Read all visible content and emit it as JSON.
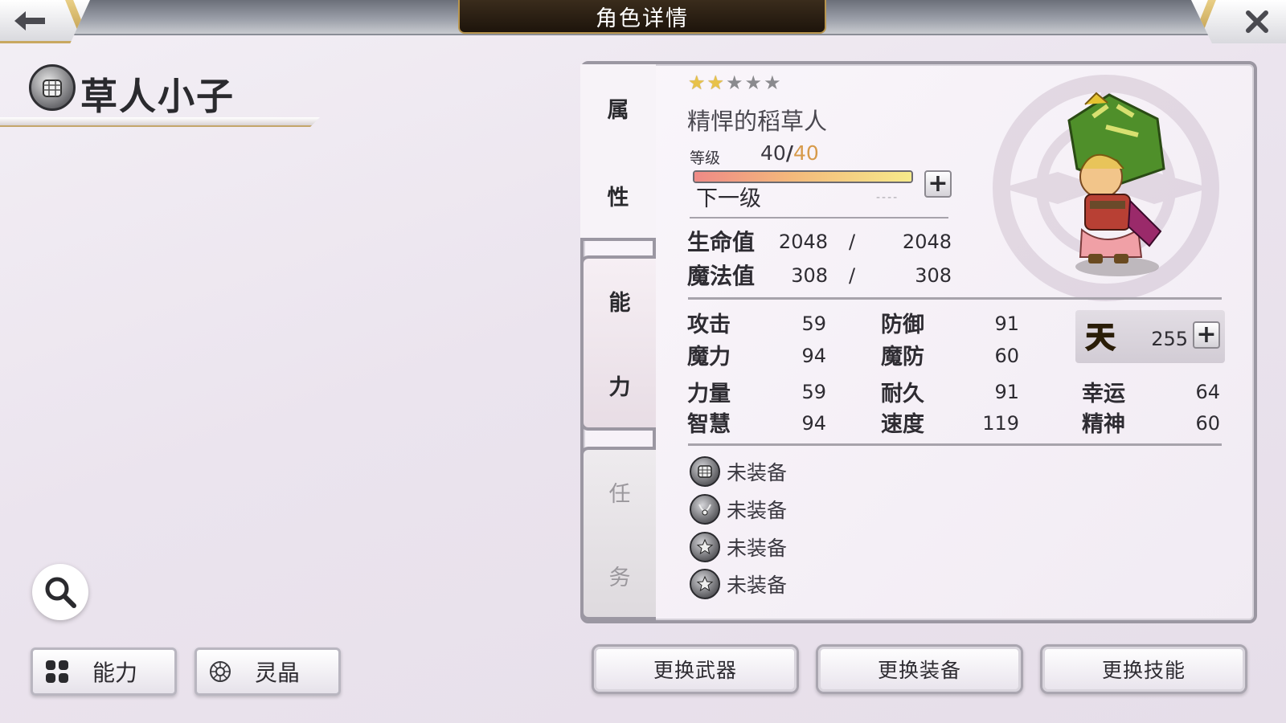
{
  "header": {
    "title": "角色详情",
    "back_icon": "arrow-left-icon",
    "close_icon": "close-icon"
  },
  "character": {
    "name": "草人小子",
    "weapon_icon": "gauntlet-icon",
    "class_name": "精悍的稻草人",
    "rarity": {
      "filled": 2,
      "total": 5
    },
    "level_label": "等级",
    "level_current": "40",
    "level_max": "40",
    "level_slash": "/",
    "xp_progress": 1.0,
    "next_label": "下一级",
    "next_value": "----"
  },
  "tabs": {
    "attributes": [
      "属",
      "性"
    ],
    "ability": [
      "能",
      "力"
    ],
    "task": [
      "任",
      "务"
    ]
  },
  "vitals": {
    "hp": {
      "label": "生命值",
      "current": "2048",
      "max": "2048",
      "sep": "/"
    },
    "mp": {
      "label": "魔法值",
      "current": "308",
      "max": "308",
      "sep": "/"
    }
  },
  "stats": {
    "attack": {
      "label": "攻击",
      "value": "59"
    },
    "magic": {
      "label": "魔力",
      "value": "94"
    },
    "defense": {
      "label": "防御",
      "value": "91"
    },
    "magic_def": {
      "label": "魔防",
      "value": "60"
    },
    "strength": {
      "label": "力量",
      "value": "59"
    },
    "wisdom": {
      "label": "智慧",
      "value": "94"
    },
    "endurance": {
      "label": "耐久",
      "value": "91"
    },
    "speed": {
      "label": "速度",
      "value": "119"
    },
    "luck": {
      "label": "幸运",
      "value": "64"
    },
    "spirit": {
      "label": "精神",
      "value": "60"
    }
  },
  "sky": {
    "icon_char": "天",
    "value": "255"
  },
  "equipment": [
    {
      "icon": "gauntlet-icon",
      "label": "未装备"
    },
    {
      "icon": "necklace-icon",
      "label": "未装备"
    },
    {
      "icon": "star-emblem-icon",
      "label": "未装备"
    },
    {
      "icon": "star-emblem-icon",
      "label": "未装备"
    }
  ],
  "left_buttons": {
    "ability": "能力",
    "crystal": "灵晶"
  },
  "bottom_buttons": {
    "weapon": "更换武器",
    "equipment": "更换装备",
    "skill": "更换技能"
  },
  "colors": {
    "gold": "#d79a4a",
    "star_gold": "#e8c24a",
    "panel_border": "#9b97a2",
    "sky_yellow": "#f6d021"
  }
}
